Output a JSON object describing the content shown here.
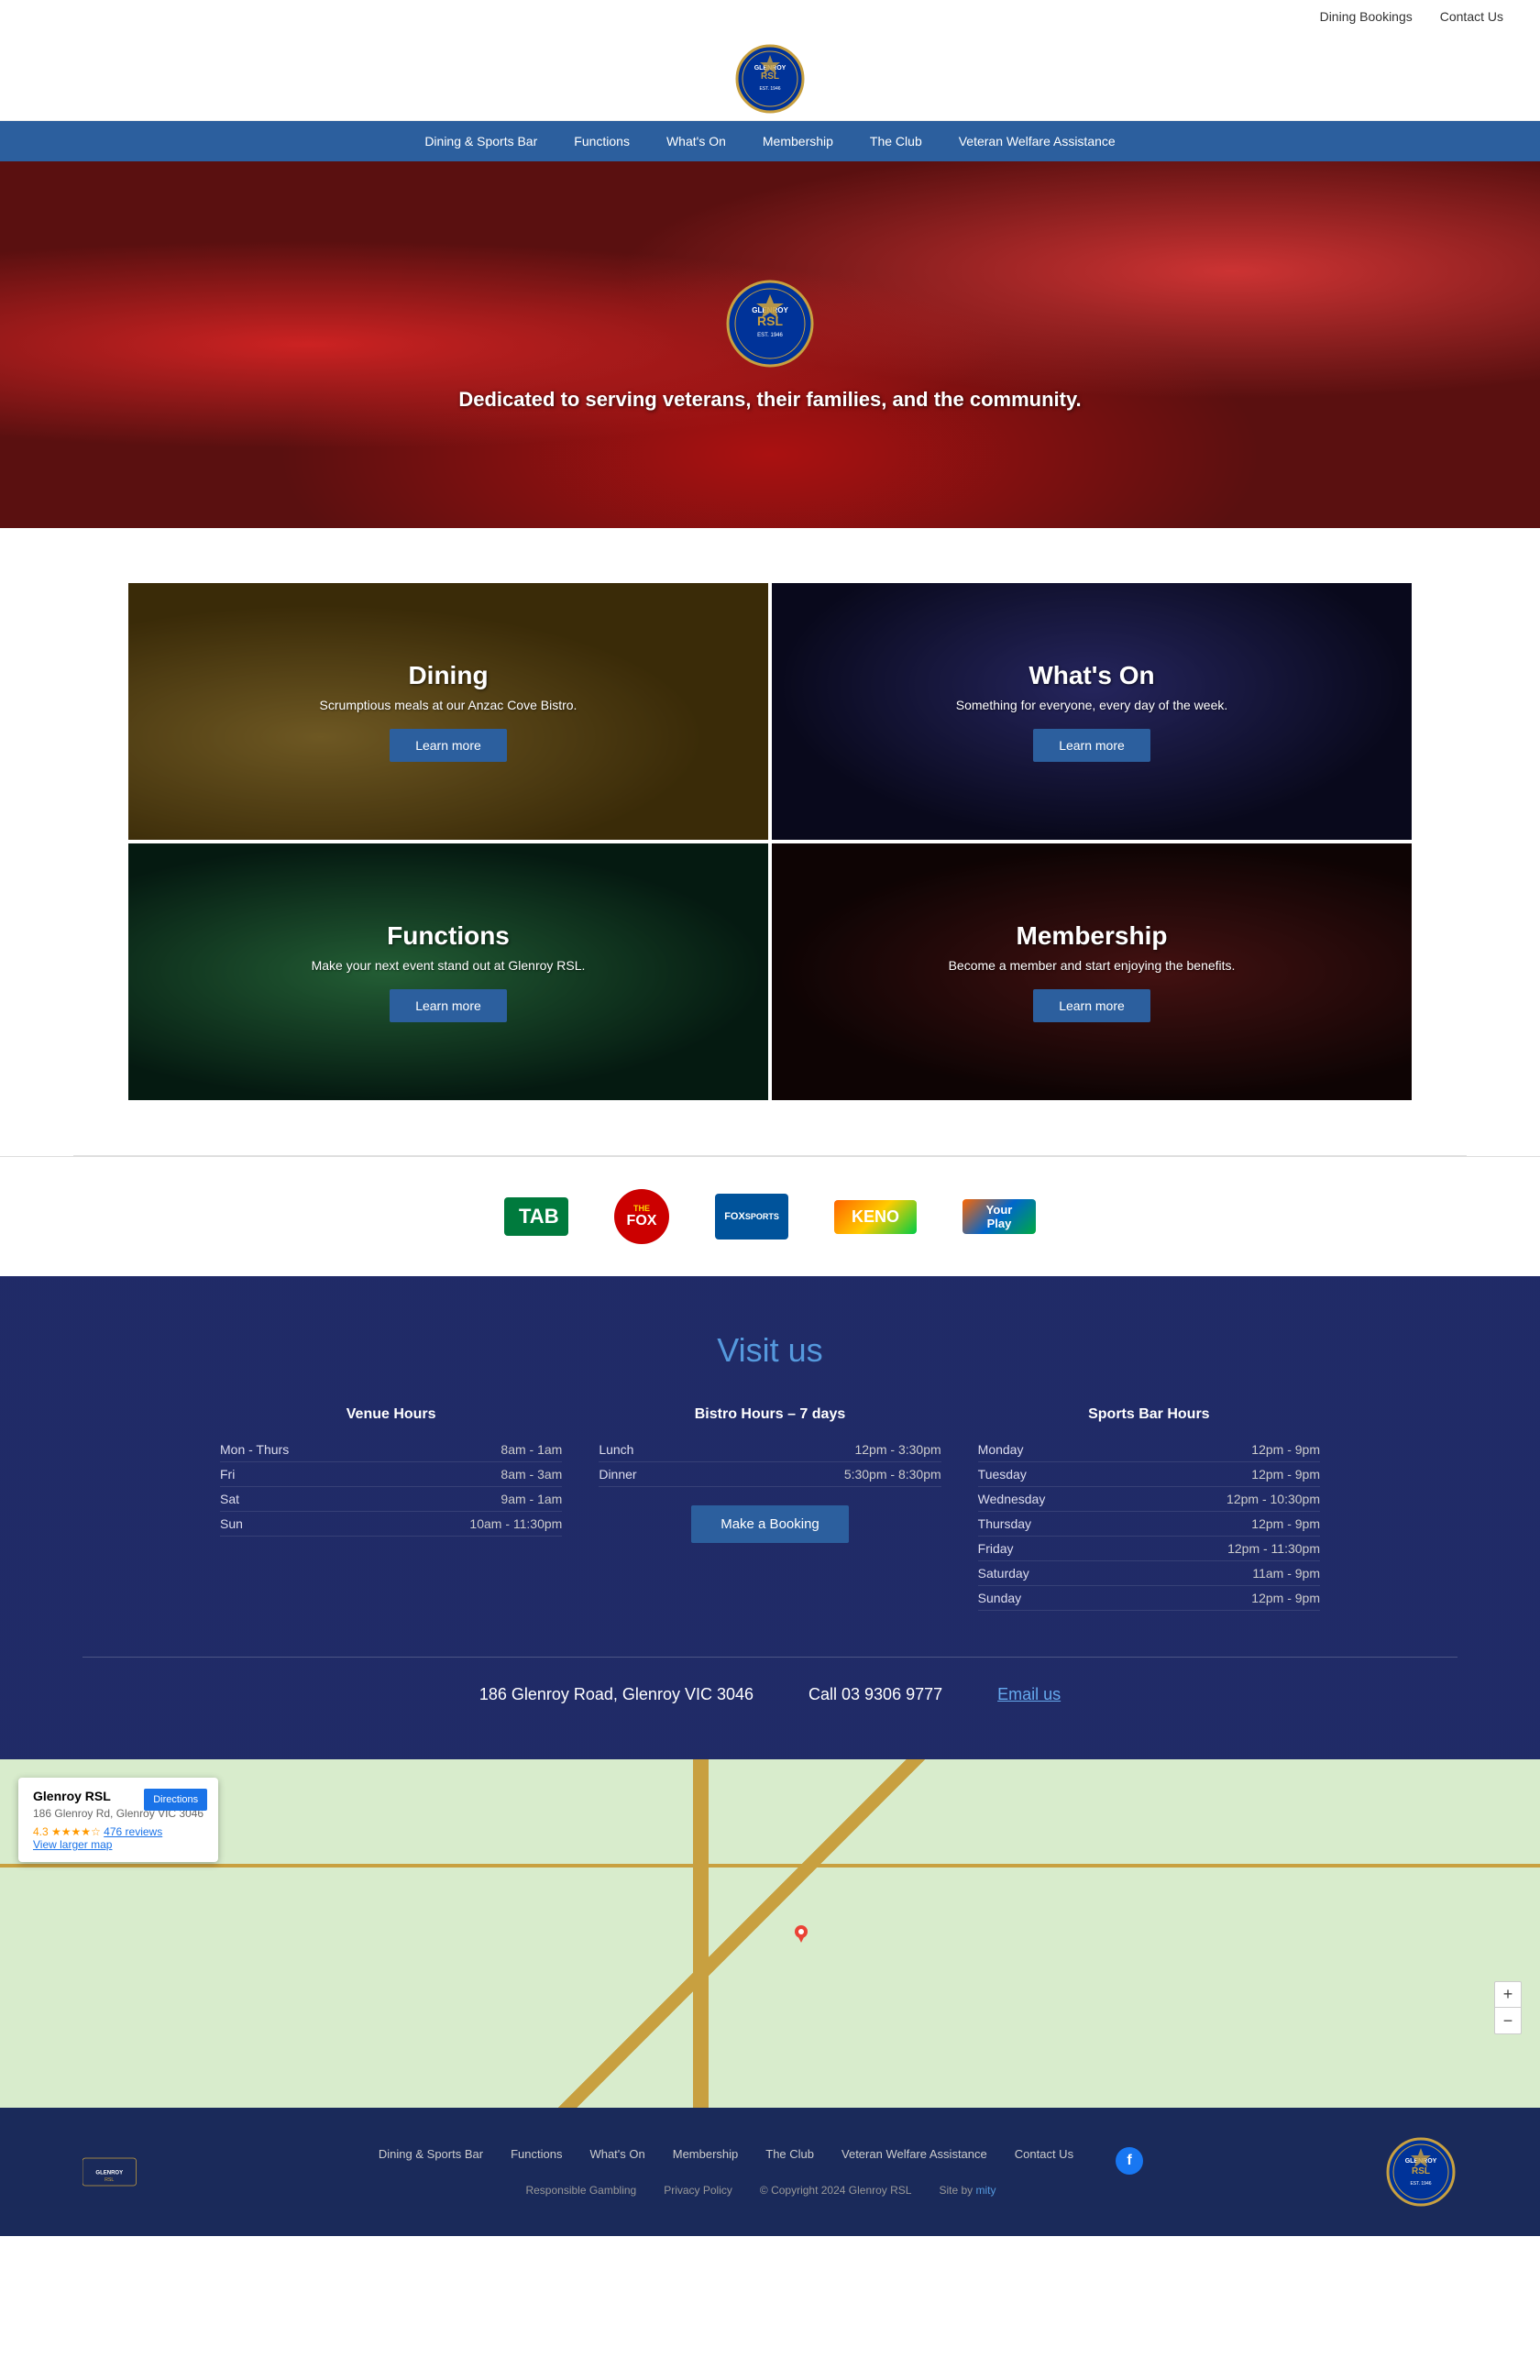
{
  "site": {
    "name": "Glenroy RSL"
  },
  "top_nav": {
    "dining_bookings": "Dining Bookings",
    "contact_us": "Contact Us"
  },
  "main_nav": {
    "items": [
      {
        "label": "Dining & Sports Bar",
        "href": "#"
      },
      {
        "label": "Functions",
        "href": "#"
      },
      {
        "label": "What's On",
        "href": "#"
      },
      {
        "label": "Membership",
        "href": "#"
      },
      {
        "label": "The Club",
        "href": "#"
      },
      {
        "label": "Veteran Welfare Assistance",
        "href": "#"
      }
    ]
  },
  "hero": {
    "tagline": "Dedicated to serving veterans, their families, and the community."
  },
  "grid": {
    "items": [
      {
        "id": "dining",
        "title": "Dining",
        "description": "Scrumptious meals at our Anzac Cove Bistro.",
        "btn_label": "Learn more"
      },
      {
        "id": "whatson",
        "title": "What's On",
        "description": "Something for everyone, every day of the week.",
        "btn_label": "Learn more"
      },
      {
        "id": "functions",
        "title": "Functions",
        "description": "Make your next event stand out at Glenroy RSL.",
        "btn_label": "Learn more"
      },
      {
        "id": "membership",
        "title": "Membership",
        "description": "Become a member and start enjoying the benefits.",
        "btn_label": "Learn more"
      }
    ]
  },
  "partners": {
    "items": [
      {
        "label": "TAB"
      },
      {
        "label": "THE FOX"
      },
      {
        "label": "FOX SPORTS"
      },
      {
        "label": "KENO"
      },
      {
        "label": "Your Play"
      }
    ]
  },
  "visit": {
    "title": "Visit us",
    "venue_hours": {
      "heading": "Venue Hours",
      "rows": [
        {
          "day": "Mon - Thurs",
          "hours": "8am - 1am"
        },
        {
          "day": "Fri",
          "hours": "8am - 3am"
        },
        {
          "day": "Sat",
          "hours": "9am - 1am"
        },
        {
          "day": "Sun",
          "hours": "10am - 11:30pm"
        }
      ]
    },
    "bistro_hours": {
      "heading": "Bistro Hours – 7 days",
      "rows": [
        {
          "meal": "Lunch",
          "hours": "12pm - 3:30pm"
        },
        {
          "meal": "Dinner",
          "hours": "5:30pm - 8:30pm"
        }
      ],
      "booking_btn": "Make a Booking"
    },
    "sports_bar_hours": {
      "heading": "Sports Bar Hours",
      "rows": [
        {
          "day": "Monday",
          "hours": "12pm - 9pm"
        },
        {
          "day": "Tuesday",
          "hours": "12pm - 9pm"
        },
        {
          "day": "Wednesday",
          "hours": "12pm - 10:30pm"
        },
        {
          "day": "Thursday",
          "hours": "12pm - 9pm"
        },
        {
          "day": "Friday",
          "hours": "12pm - 11:30pm"
        },
        {
          "day": "Saturday",
          "hours": "11am - 9pm"
        },
        {
          "day": "Sunday",
          "hours": "12pm - 9pm"
        }
      ]
    }
  },
  "contact": {
    "address": "186 Glenroy Road, Glenroy VIC 3046",
    "phone": "Call 03 9306 9777",
    "email": "Email us"
  },
  "map": {
    "place_name": "Glenroy RSL",
    "place_address": "186 Glenroy Rd, Glenroy VIC 3046",
    "rating": "4.3",
    "stars": "★★★★☆",
    "reviews_count": "476 reviews",
    "view_larger": "View larger map",
    "directions_btn": "Directions"
  },
  "footer": {
    "nav_items": [
      {
        "label": "Dining & Sports Bar"
      },
      {
        "label": "Functions"
      },
      {
        "label": "What's On"
      },
      {
        "label": "Membership"
      },
      {
        "label": "The Club"
      },
      {
        "label": "Veteran Welfare Assistance"
      },
      {
        "label": "Contact Us"
      }
    ],
    "bottom_items": [
      {
        "label": "Responsible Gambling"
      },
      {
        "label": "Privacy Policy"
      },
      {
        "label": "© Copyright 2024 Glenroy RSL"
      },
      {
        "label": "Site by"
      },
      {
        "label": "mity"
      }
    ]
  }
}
